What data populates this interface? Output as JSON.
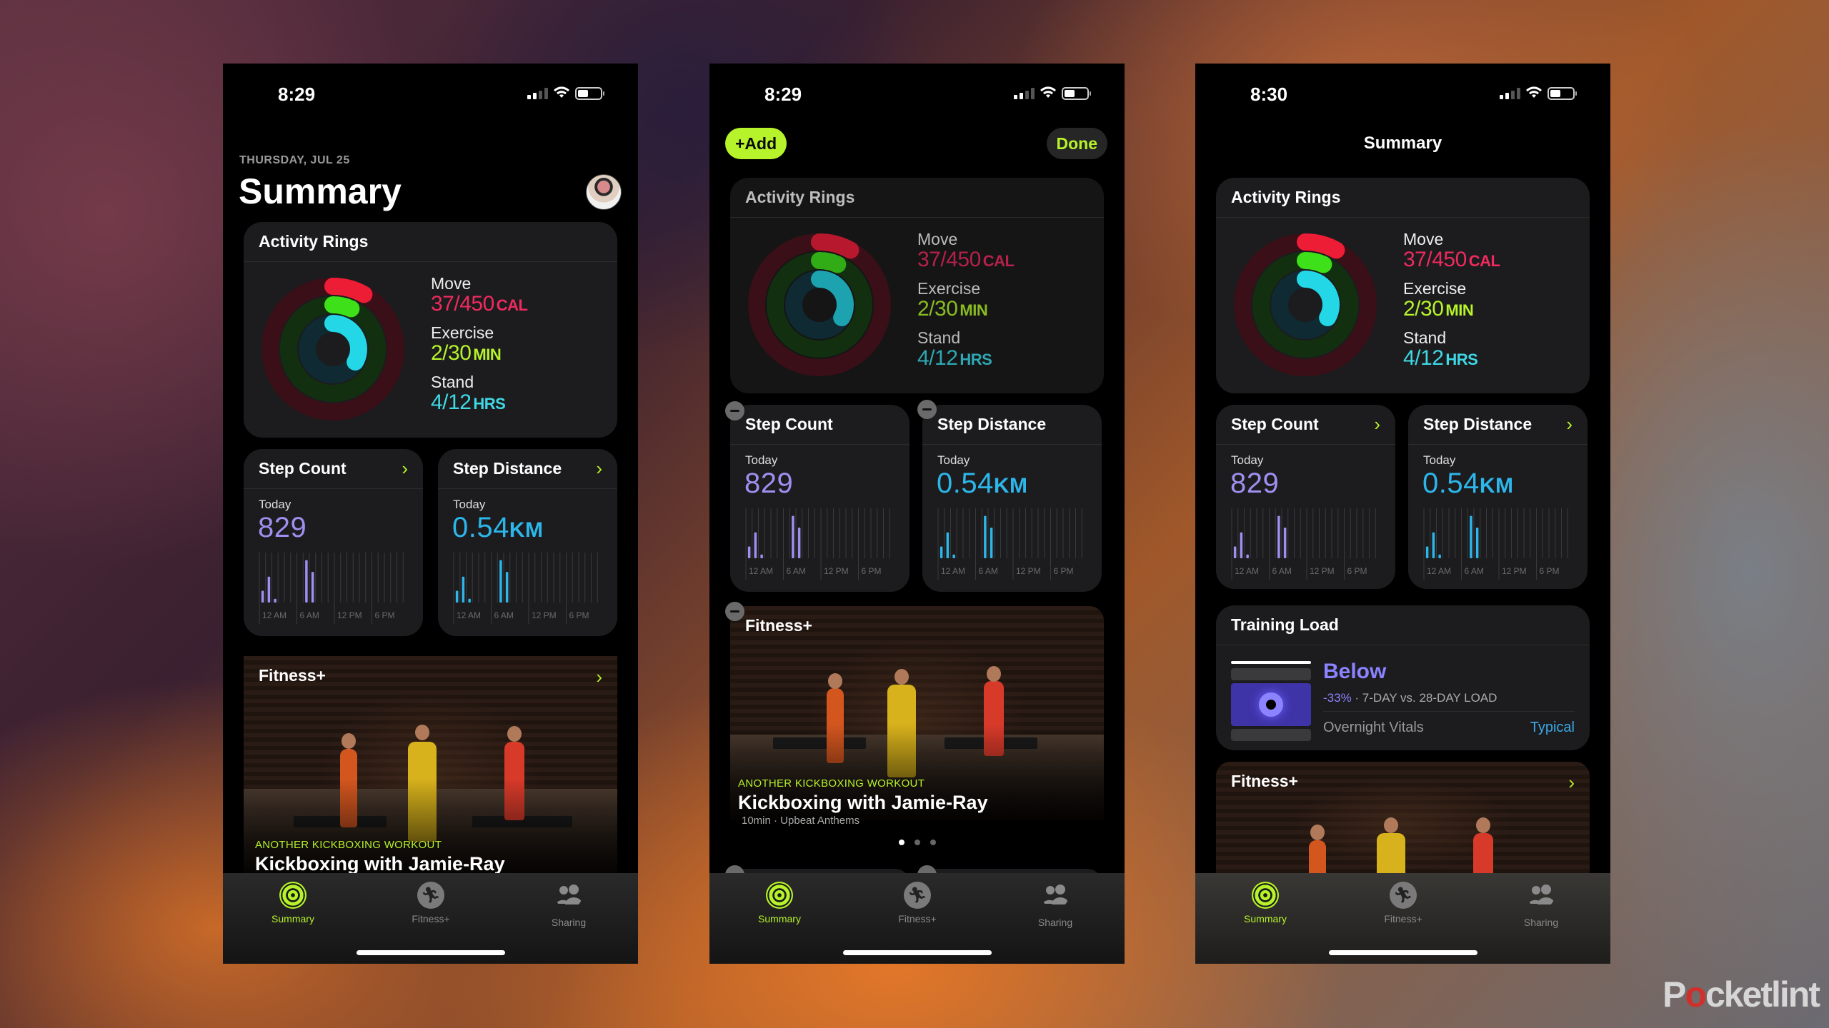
{
  "colors": {
    "move": "#ee2a5e",
    "exercise": "#b6f32a",
    "stand": "#3fd9e6",
    "accent": "#b6f32a",
    "steps": "#9f8ff0",
    "distance": "#2cb6ea",
    "training": "#8b83ff",
    "typical": "#3ba9e8"
  },
  "common": {
    "activity_rings_title": "Activity Rings",
    "move_label": "Move",
    "move_value": "37/450",
    "move_unit": "CAL",
    "move_progress": 0.082,
    "exercise_label": "Exercise",
    "exercise_value": "2/30",
    "exercise_unit": "MIN",
    "exercise_progress": 0.067,
    "stand_label": "Stand",
    "stand_value": "4/12",
    "stand_unit": "HRS",
    "stand_progress": 0.333,
    "step_count_title": "Step Count",
    "step_distance_title": "Step Distance",
    "today_label": "Today",
    "step_count_value": "829",
    "step_distance_value": "0.54",
    "step_distance_unit": "KM",
    "chart_ticks": [
      "12 AM",
      "6 AM",
      "12 PM",
      "6 PM"
    ],
    "hourly_steps_relative": [
      0.25,
      0.55,
      0.08,
      0,
      0,
      0,
      0,
      0.9,
      0.65,
      0,
      0,
      0,
      0,
      0,
      0,
      0,
      0,
      0,
      0,
      0,
      0,
      0,
      0,
      0
    ],
    "chevron": "›",
    "fitness_title": "Fitness+",
    "workout_eyebrow": "ANOTHER KICKBOXING WORKOUT",
    "workout_title": "Kickboxing with Jamie-Ray",
    "workout_subtitle": "10min · Upbeat Anthems",
    "tabs": [
      {
        "label": "Summary",
        "icon": "activity-rings-icon",
        "active": true
      },
      {
        "label": "Fitness+",
        "icon": "runner-icon",
        "active": false
      },
      {
        "label": "Sharing",
        "icon": "people-icon",
        "active": false
      }
    ]
  },
  "phone1": {
    "time": "8:29",
    "date": "THURSDAY, JUL 25",
    "title": "Summary"
  },
  "phone2": {
    "time": "8:29",
    "add_button": "+Add",
    "done_button": "Done",
    "carousel_page": 1,
    "carousel_pages": 3
  },
  "phone3": {
    "time": "8:30",
    "title": "Summary",
    "training_load": {
      "title": "Training Load",
      "status": "Below",
      "percent": "-33%",
      "detail": " · 7-DAY vs. 28-DAY LOAD",
      "vitals_label": "Overnight Vitals",
      "vitals_value": "Typical"
    }
  },
  "watermark": {
    "pre": "P",
    "o": "o",
    "post": "cketlint"
  }
}
